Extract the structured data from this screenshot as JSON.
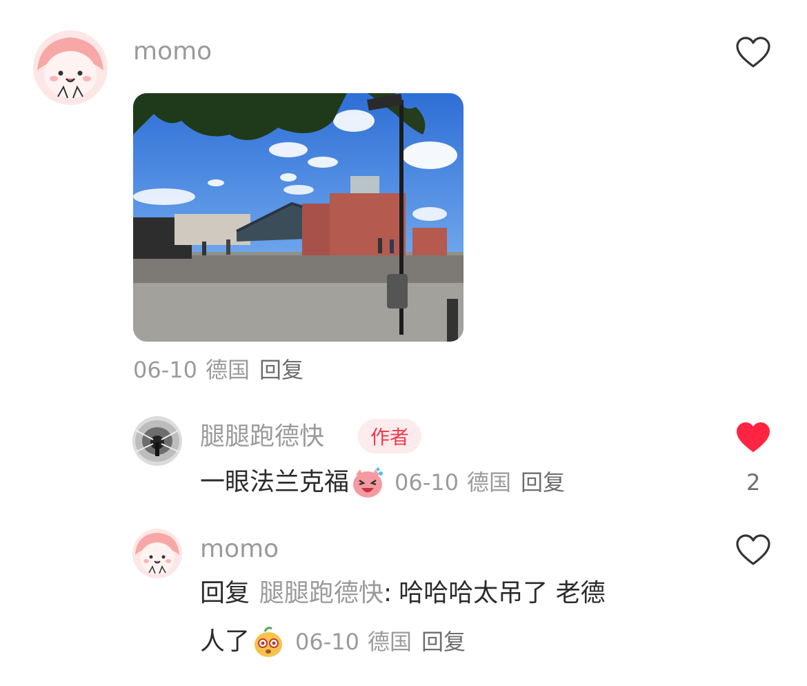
{
  "comments": [
    {
      "username": "momo",
      "date": "06-10",
      "location": "德国",
      "reply_label": "回复",
      "liked": false
    }
  ],
  "replies": [
    {
      "username": "腿腿跑德快",
      "badge": "作者",
      "text": "一眼法兰克福",
      "emoji": "laughing-pig-emoji",
      "date": "06-10",
      "location": "德国",
      "reply_label": "回复",
      "liked": true,
      "like_count": "2"
    },
    {
      "username": "momo",
      "reply_prefix": "回复",
      "reply_to": "腿腿跑德快",
      "colon": ":",
      "text_line1": "哈哈哈太吊了 老德",
      "text_line2": "人了",
      "emoji": "surprised-bean-emoji",
      "date": "06-10",
      "location": "德国",
      "reply_label": "回复",
      "liked": false
    }
  ],
  "colors": {
    "accent_red": "#ff2442",
    "muted_text": "#9a9a9a",
    "main_text": "#2b2b2b"
  }
}
